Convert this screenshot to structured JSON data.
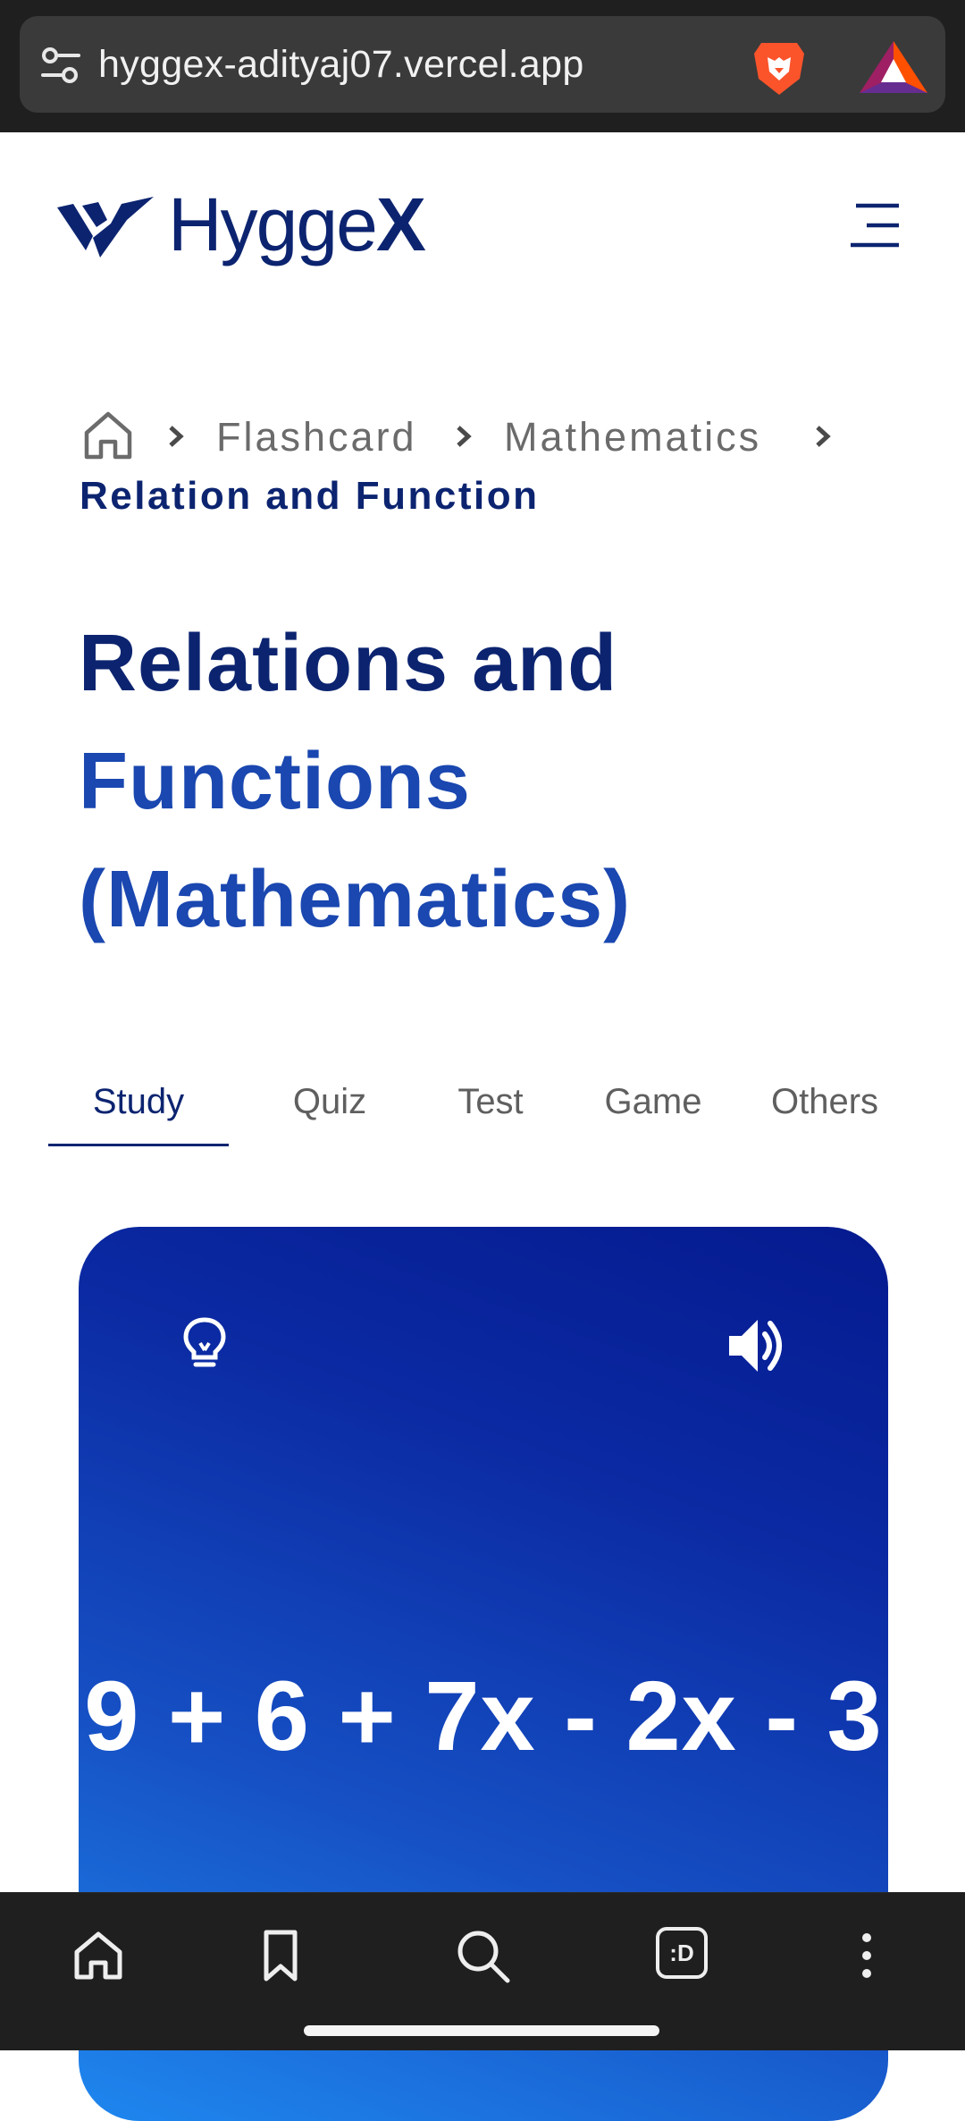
{
  "browser": {
    "url": "hyggex-adityaj07.vercel.app",
    "icons": [
      "site-settings-icon",
      "brave-lion-icon",
      "bat-rewards-icon"
    ]
  },
  "header": {
    "logo_text_main": "Hygge",
    "logo_text_accent": "X",
    "menu_icon": "hamburger-menu-icon"
  },
  "breadcrumb": {
    "home_icon": "home-icon",
    "items": [
      "Flashcard",
      "Mathematics"
    ],
    "current": "Relation and Function"
  },
  "title": {
    "line1": "Relations and",
    "line2": "Functions",
    "line3": "(Mathematics)"
  },
  "tabs": [
    {
      "label": "Study",
      "active": true
    },
    {
      "label": "Quiz",
      "active": false
    },
    {
      "label": "Test",
      "active": false
    },
    {
      "label": "Game",
      "active": false
    },
    {
      "label": "Others",
      "active": false
    }
  ],
  "flashcard": {
    "text": "9 + 6 + 7x - 2x - 3",
    "hint_icon": "lightbulb-icon",
    "audio_icon": "speaker-icon"
  },
  "bottom_nav": {
    "icons": [
      "home-icon",
      "bookmark-icon",
      "search-icon",
      "tabs-icon",
      "more-icon"
    ],
    "tabs_label": ":D"
  },
  "colors": {
    "brand_dark": "#0c2470",
    "brand_blue": "#1a47b0",
    "card_gradient_start": "#051a8f",
    "card_gradient_end": "#1f87ef",
    "browser_chrome": "#1f1f1f"
  }
}
